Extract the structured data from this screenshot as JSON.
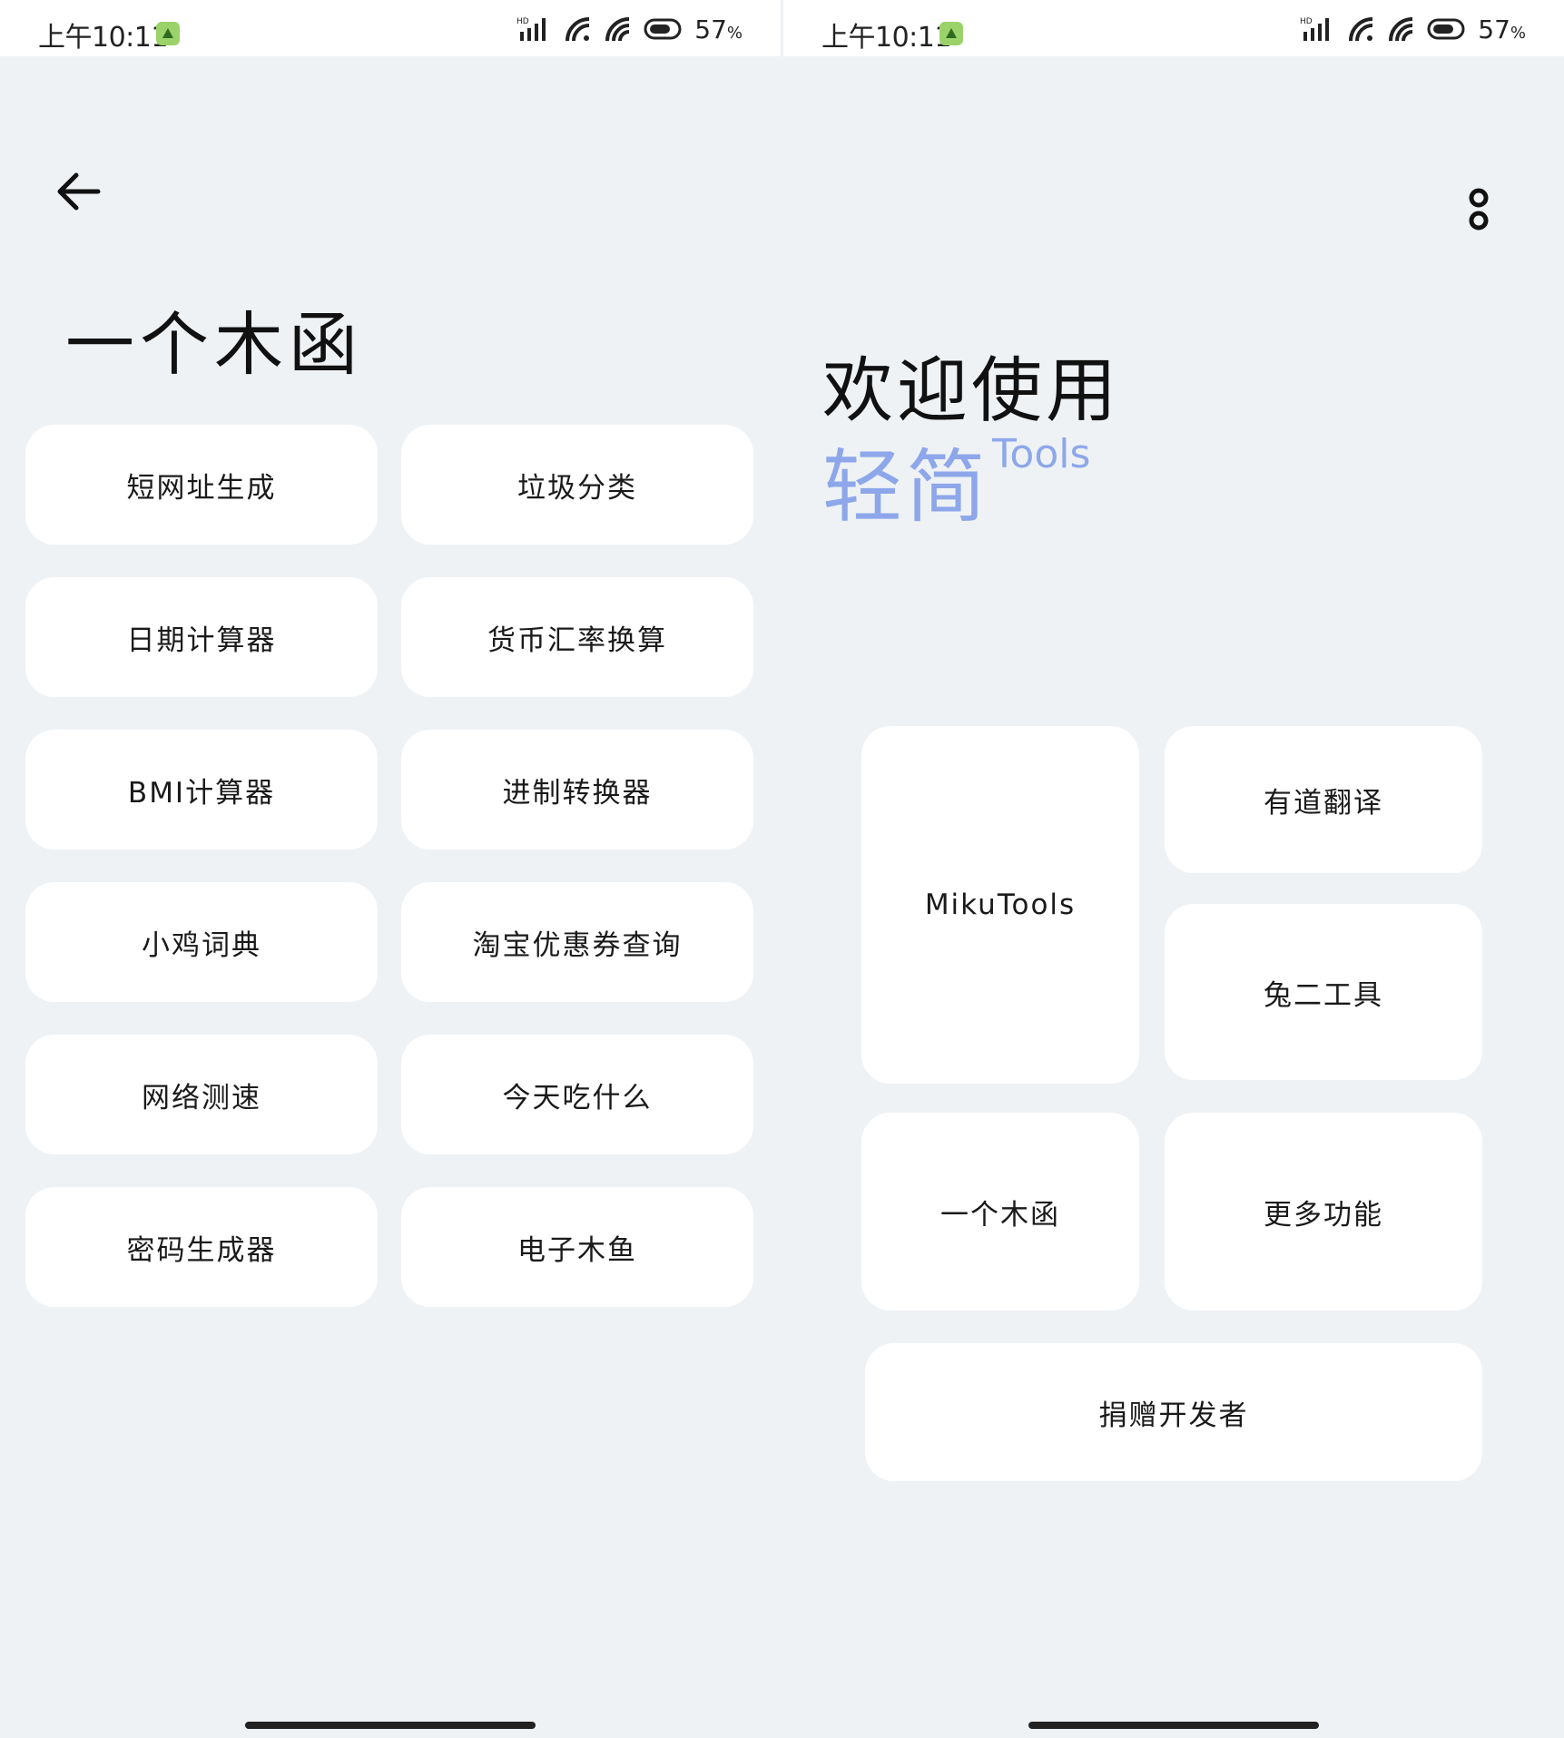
{
  "status_bar": {
    "time": "上午10:11",
    "battery": "57",
    "battery_unit": "%"
  },
  "left_screen": {
    "title": "一个木函",
    "tools": [
      "短网址生成",
      "垃圾分类",
      "日期计算器",
      "货币汇率换算",
      "BMI计算器",
      "进制转换器",
      "小鸡词典",
      "淘宝优惠券查询",
      "网络测速",
      "今天吃什么",
      "密码生成器",
      "电子木鱼"
    ]
  },
  "right_screen": {
    "welcome": "欢迎使用",
    "brand_cn": "轻简",
    "brand_en": "Tools",
    "buttons": {
      "mikutools": "MikuTools",
      "youdao": "有道翻译",
      "tuer": "兔二工具",
      "muhan": "一个木函",
      "more": "更多功能",
      "donate": "捐赠开发者"
    }
  },
  "colors": {
    "background": "#eff2f5",
    "card": "#ffffff",
    "brand": "#8da7ea"
  }
}
